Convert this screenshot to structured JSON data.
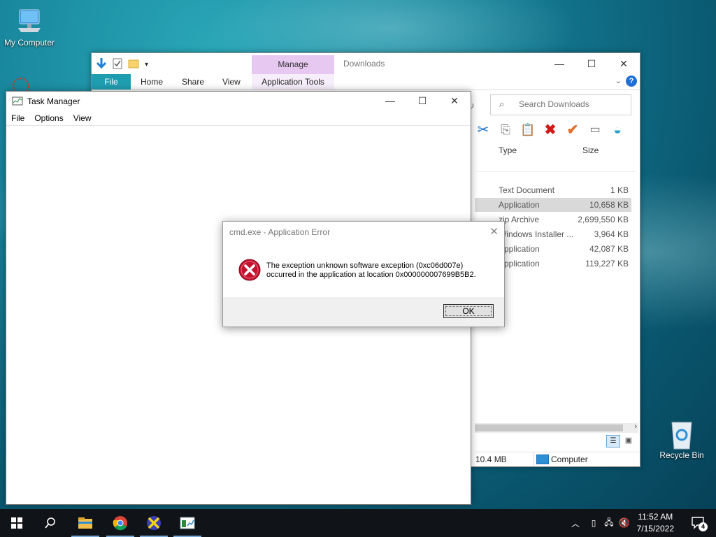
{
  "desktop": {
    "icons": [
      {
        "label": "My Computer"
      },
      {
        "label": "Recycle Bin"
      }
    ]
  },
  "explorer": {
    "title": "Downloads",
    "contextual_group": "Manage",
    "ribbon_tabs": [
      "File",
      "Home",
      "Share",
      "View",
      "Application Tools"
    ],
    "search_placeholder": "Search Downloads",
    "columns": {
      "type": "Type",
      "size": "Size"
    },
    "files": [
      {
        "type": "Text Document",
        "size": "1 KB",
        "selected": false
      },
      {
        "type": "Application",
        "size": "10,658 KB",
        "selected": true
      },
      {
        "type": "zip Archive",
        "size": "2,699,550 KB",
        "selected": false
      },
      {
        "type": "Windows Installer ...",
        "size": "3,964 KB",
        "selected": false
      },
      {
        "type": "Application",
        "size": "42,087 KB",
        "selected": false
      },
      {
        "type": "Application",
        "size": "119,227 KB",
        "selected": false
      }
    ],
    "status": {
      "size": "10.4 MB",
      "location": "Computer"
    }
  },
  "taskmgr": {
    "title": "Task Manager",
    "menu": [
      "File",
      "Options",
      "View"
    ]
  },
  "dialog": {
    "title": "cmd.exe - Application Error",
    "message_line1": "The exception unknown software exception (0xc06d007e)",
    "message_line2": "occurred in the application at location 0x000000007699B5B2.",
    "ok_label": "OK"
  },
  "taskbar": {
    "clock_time": "11:52 AM",
    "clock_date": "7/15/2022",
    "notification_count": "4",
    "apps": [
      "start-icon",
      "search-icon",
      "file-explorer-icon",
      "chrome-icon",
      "cross-app-icon",
      "task-manager-icon"
    ]
  },
  "colors": {
    "ribbon_file_tab": "#1f9db0",
    "manage_tab": "#e6c8f0",
    "error_red": "#c4122f",
    "taskbar": "#101418"
  }
}
